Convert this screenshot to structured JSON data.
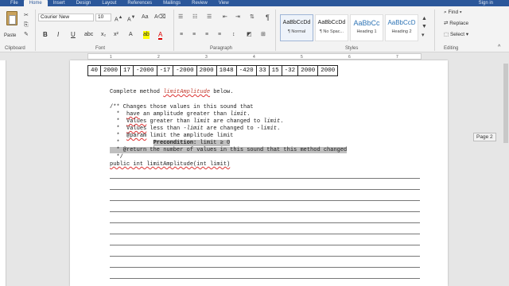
{
  "tabs": [
    "File",
    "Home",
    "Insert",
    "Design",
    "Layout",
    "References",
    "Mailings",
    "Review",
    "View"
  ],
  "active_tab": "Home",
  "signin": "Sign in",
  "clipboard": {
    "paste_label": "Paste",
    "group": "Clipboard"
  },
  "font": {
    "name": "Courier New",
    "size": "10",
    "group": "Font",
    "bold": "B",
    "italic": "I",
    "underline": "U",
    "sub": "x₂",
    "sup": "x²",
    "color": "A"
  },
  "paragraph": {
    "group": "Paragraph",
    "pilcrow": "¶"
  },
  "styles": {
    "group": "Styles",
    "items": [
      {
        "preview": "AaBbCcDd",
        "name": "¶ Normal"
      },
      {
        "preview": "AaBbCcDd",
        "name": "¶ No Spac..."
      },
      {
        "preview": "AaBbCc",
        "name": "Heading 1"
      },
      {
        "preview": "AaBbCcD",
        "name": "Heading 2"
      }
    ]
  },
  "editing": {
    "group": "Editing",
    "find": "Find",
    "replace": "Replace",
    "select": "Select"
  },
  "ruler_numbers": [
    "1",
    "2",
    "3",
    "4",
    "5",
    "6",
    "7"
  ],
  "values_row": [
    "40",
    "2000",
    "17",
    "-2000",
    "-17",
    "-2000",
    "2000",
    "1048",
    "-420",
    "33",
    "15",
    "-32",
    "2000",
    "2000"
  ],
  "doc": {
    "instr_pre": "Complete method ",
    "instr_method": "limitAmplitude",
    "instr_post": " below.",
    "l1": "/** Changes those values in this sound that",
    "l2a": "  *  ",
    "l2b": "have",
    "l2c": " an amplitude greater than ",
    "l2d": "limit",
    "l2e": ".",
    "l3a": "  *  ",
    "l3b": "Values",
    "l3c": " greater than ",
    "l3d": "limit",
    "l3e": " are changed to ",
    "l3f": "limit",
    "l3g": ".",
    "l4a": "  *  ",
    "l4b": "Values",
    "l4c": " less than ",
    "l4d": "-limit",
    "l4e": " are changed to ",
    "l4f": "-limit",
    "l4g": ".",
    "l5a": "  *  ",
    "l5b": "@param",
    "l5c": " limit the amplitude limit",
    "l6a": "  *          ",
    "l6b": "Precondition:",
    "l6c": " limit ≥ 0",
    "l7": "  * @return the number of values in this sound that this method changed",
    "l8": "  */",
    "sig_a": "public int limitAmplitude(int limit)"
  },
  "page_tag": "Page 2"
}
